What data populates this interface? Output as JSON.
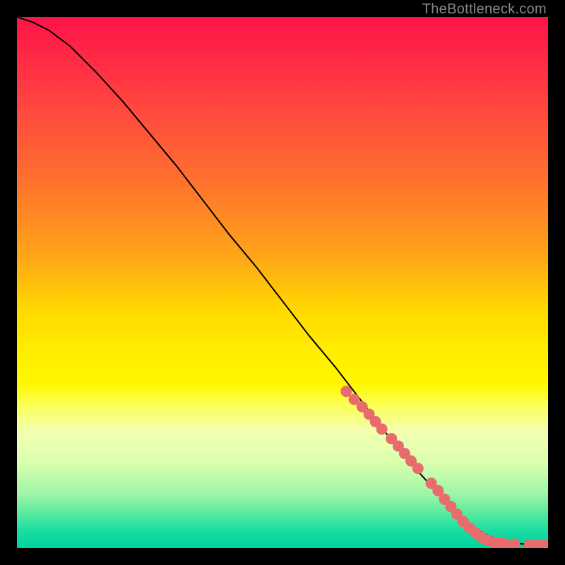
{
  "watermark": "TheBottleneck.com",
  "colors": {
    "dot": "#e86c6c",
    "line": "#000000",
    "frame": "#000000"
  },
  "chart_data": {
    "type": "line",
    "title": "",
    "xlabel": "",
    "ylabel": "",
    "xlim": [
      0,
      100
    ],
    "ylim": [
      0,
      100
    ],
    "grid": false,
    "legend": false,
    "series": [
      {
        "name": "curve",
        "x": [
          0,
          3,
          6,
          10,
          15,
          20,
          25,
          30,
          35,
          40,
          45,
          50,
          55,
          60,
          65,
          70,
          75,
          80,
          82,
          84,
          86,
          88,
          90,
          92,
          94,
          96,
          98,
          100
        ],
        "y": [
          100,
          99,
          97.5,
          94.5,
          89.5,
          84,
          78,
          72,
          65.5,
          59,
          53,
          46.5,
          40,
          34,
          27.5,
          21,
          15,
          9.5,
          7,
          5.2,
          3.8,
          2.7,
          1.8,
          1.2,
          0.9,
          0.7,
          0.55,
          0.5
        ]
      }
    ],
    "points": [
      {
        "x": 62,
        "y": 29.5
      },
      {
        "x": 63.5,
        "y": 28.0
      },
      {
        "x": 65,
        "y": 26.6
      },
      {
        "x": 66.3,
        "y": 25.2
      },
      {
        "x": 67.5,
        "y": 23.8
      },
      {
        "x": 68.7,
        "y": 22.4
      },
      {
        "x": 70.5,
        "y": 20.6
      },
      {
        "x": 71.8,
        "y": 19.2
      },
      {
        "x": 73,
        "y": 17.8
      },
      {
        "x": 74.2,
        "y": 16.4
      },
      {
        "x": 75.5,
        "y": 15
      },
      {
        "x": 78,
        "y": 12.2
      },
      {
        "x": 79.3,
        "y": 10.8
      },
      {
        "x": 80.5,
        "y": 9.2
      },
      {
        "x": 81.7,
        "y": 7.8
      },
      {
        "x": 82.8,
        "y": 6.4
      },
      {
        "x": 84,
        "y": 5
      },
      {
        "x": 85.2,
        "y": 3.8
      },
      {
        "x": 86.4,
        "y": 2.8
      },
      {
        "x": 87.5,
        "y": 2
      },
      {
        "x": 88.5,
        "y": 1.5
      },
      {
        "x": 89.6,
        "y": 1.15
      },
      {
        "x": 90.7,
        "y": 0.95
      },
      {
        "x": 91.8,
        "y": 0.85
      },
      {
        "x": 93.7,
        "y": 0.75
      },
      {
        "x": 96.5,
        "y": 0.65
      },
      {
        "x": 98,
        "y": 0.6
      },
      {
        "x": 99.3,
        "y": 0.55
      }
    ]
  }
}
